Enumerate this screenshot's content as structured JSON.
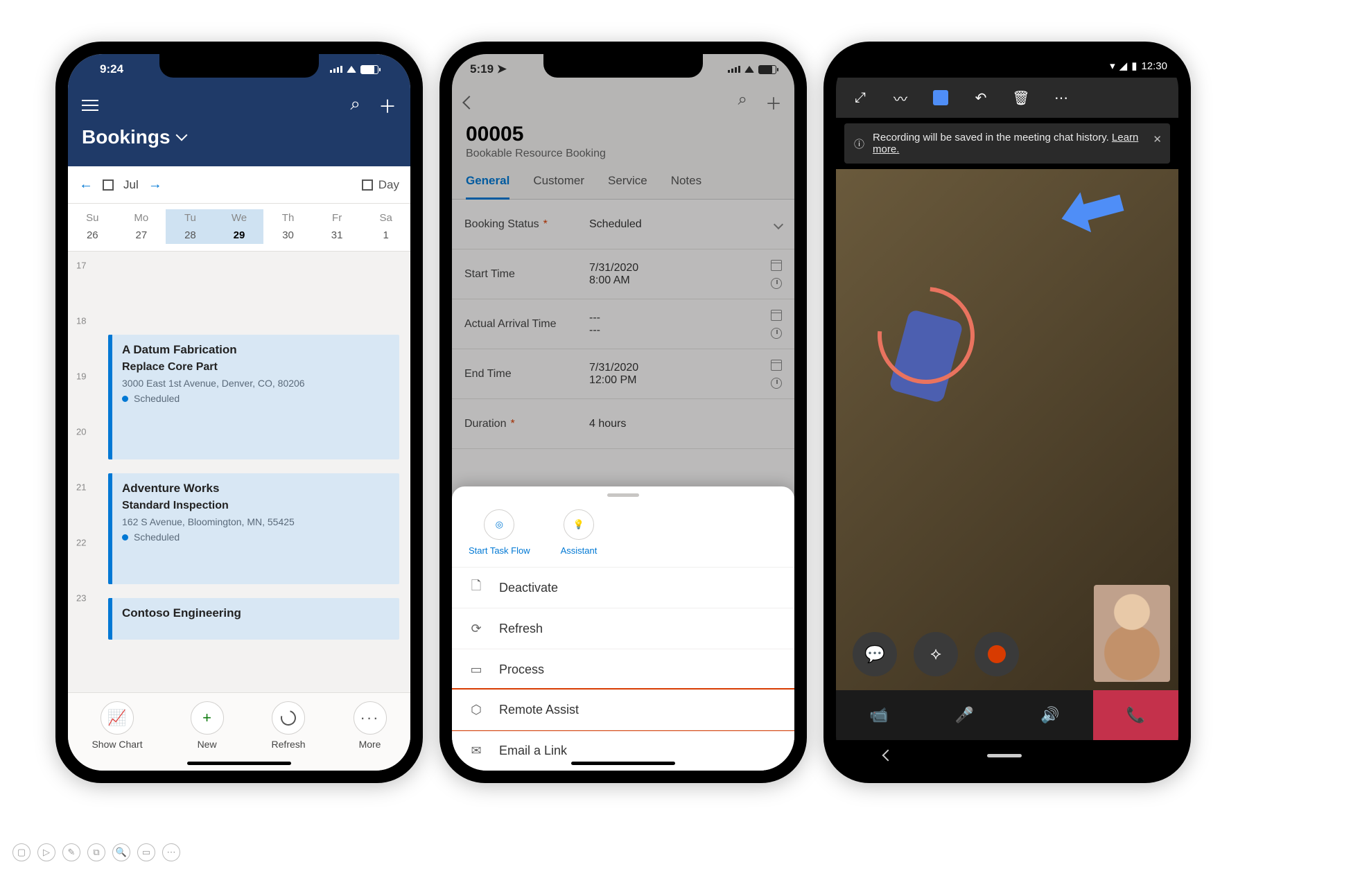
{
  "phone1": {
    "status_time": "9:24",
    "page_title": "Bookings",
    "calnav": {
      "month": "Jul",
      "view": "Day"
    },
    "week": {
      "headers": [
        "Su",
        "Mo",
        "Tu",
        "We",
        "Th",
        "Fr",
        "Sa"
      ],
      "dates": [
        "26",
        "27",
        "28",
        "29",
        "30",
        "31",
        "1"
      ],
      "selected_index": 2,
      "today_index": 3
    },
    "hours": [
      "17",
      "18",
      "19",
      "20",
      "21",
      "22",
      "23"
    ],
    "bookings": [
      {
        "company": "A Datum Fabrication",
        "task": "Replace Core Part",
        "address": "3000 East 1st Avenue, Denver, CO, 80206",
        "status": "Scheduled"
      },
      {
        "company": "Adventure Works",
        "task": "Standard Inspection",
        "address": "162 S Avenue, Bloomington, MN, 55425",
        "status": "Scheduled"
      },
      {
        "company": "Contoso Engineering",
        "task": "",
        "address": "",
        "status": ""
      }
    ],
    "bottom": {
      "show_chart": "Show Chart",
      "new": "New",
      "refresh": "Refresh",
      "more": "More"
    }
  },
  "phone2": {
    "status_time": "5:19",
    "record_id": "00005",
    "record_type": "Bookable Resource Booking",
    "tabs": [
      "General",
      "Customer",
      "Service",
      "Notes"
    ],
    "active_tab": "General",
    "fields": {
      "booking_status": {
        "label": "Booking Status",
        "value": "Scheduled",
        "required": true
      },
      "start_time": {
        "label": "Start Time",
        "date": "7/31/2020",
        "time": "8:00 AM"
      },
      "actual_arrival": {
        "label": "Actual Arrival Time",
        "date": "---",
        "time": "---"
      },
      "end_time": {
        "label": "End Time",
        "date": "7/31/2020",
        "time": "12:00 PM"
      },
      "duration": {
        "label": "Duration",
        "value": "4 hours",
        "required": true
      }
    },
    "sheet": {
      "pills": {
        "start_task_flow": "Start Task Flow",
        "assistant": "Assistant"
      },
      "menu": [
        "Deactivate",
        "Refresh",
        "Process",
        "Remote Assist",
        "Email a Link"
      ],
      "highlighted": "Remote Assist"
    }
  },
  "phone3": {
    "status_time": "12:30",
    "notification": {
      "text": "Recording will be saved in the meeting chat history.",
      "link": "Learn more."
    }
  }
}
